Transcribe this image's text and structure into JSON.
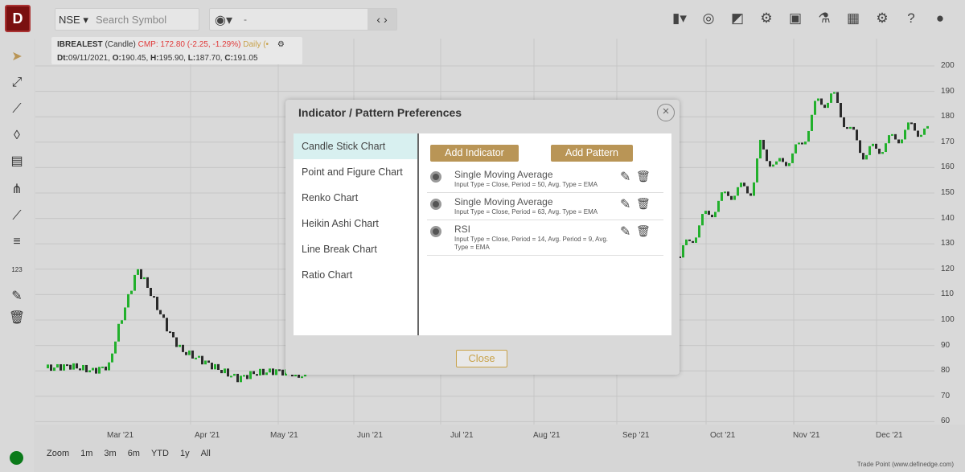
{
  "logo": {
    "letter": "D"
  },
  "toolbar": {
    "exchange": "NSE",
    "search_placeholder": "Search Symbol",
    "nav_value": "-",
    "icons": [
      "candle-type-icon",
      "indicator-icon",
      "drawing-icon",
      "scanner-icon",
      "save-icon",
      "experiment-icon",
      "layout-icon",
      "settings-icon",
      "help-icon",
      "user-icon"
    ]
  },
  "left_tools": [
    "pointer-icon",
    "line-tool-icon",
    "trend-line-icon",
    "shape-icon",
    "text-note-icon",
    "fork-icon",
    "channel-icon",
    "fib-icon",
    "measure-icon",
    "brush-icon",
    "trash-icon"
  ],
  "chart_info": {
    "symbol": "IBREALEST",
    "type": "(Candle)",
    "cmp": "CMP: 172.80 (-2.25, -1.29%)",
    "timeframe": "Daily (•",
    "dt": "Dt:",
    "dt_val": "09/11/2021, ",
    "o": "O:",
    "o_val": "190.45, ",
    "h": "H:",
    "h_val": "195.90, ",
    "l": "L:",
    "l_val": "187.70, ",
    "c": "C:",
    "c_val": "191.05"
  },
  "y_axis": [
    "200",
    "190",
    "180",
    "170",
    "160",
    "150",
    "140",
    "130",
    "120",
    "110",
    "100",
    "90",
    "80",
    "70",
    "60"
  ],
  "x_axis": [
    "Mar '21",
    "Apr '21",
    "May '21",
    "Jun '21",
    "Jul '21",
    "Aug '21",
    "Sep '21",
    "Oct '21",
    "Nov '21",
    "Dec '21"
  ],
  "zoom": {
    "label": "Zoom",
    "options": [
      "1m",
      "3m",
      "6m",
      "YTD",
      "1y",
      "All"
    ]
  },
  "credit": "Trade Point (www.definedge.com)",
  "dialog": {
    "title": "Indicator / Pattern Preferences",
    "close_symbol": "×",
    "chart_types": [
      "Candle Stick Chart",
      "Point and Figure Chart",
      "Renko Chart",
      "Heikin Ashi Chart",
      "Line Break Chart",
      "Ratio Chart"
    ],
    "add_indicator": "Add Indicator",
    "add_pattern": "Add Pattern",
    "indicators": [
      {
        "name": "Single Moving Average",
        "params": "Input Type = Close, Period = 50, Avg. Type = EMA"
      },
      {
        "name": "Single Moving Average",
        "params": "Input Type = Close, Period = 63, Avg. Type = EMA"
      },
      {
        "name": "RSI",
        "params": "Input Type = Close, Period = 14, Avg. Period = 9, Avg. Type = EMA"
      }
    ],
    "close_button": "Close"
  },
  "colors": {
    "up": "#22b02c",
    "down": "#2a2a2a",
    "accent": "#b99556",
    "cmp": "#e03a3a"
  }
}
